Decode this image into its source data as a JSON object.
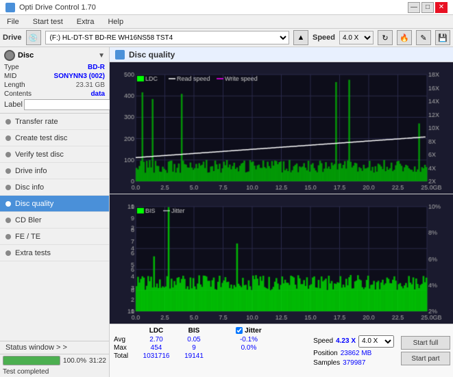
{
  "app": {
    "title": "Opti Drive Control 1.70",
    "icon": "ODC"
  },
  "title_controls": {
    "minimize": "—",
    "maximize": "□",
    "close": "✕"
  },
  "menu": {
    "items": [
      "File",
      "Start test",
      "Extra",
      "Help"
    ]
  },
  "toolbar": {
    "drive_label": "Drive",
    "drive_value": "(F:) HL-DT-ST BD-RE  WH16NS58 TST4",
    "speed_label": "Speed",
    "speed_value": "4.0 X"
  },
  "disc": {
    "header": "Disc",
    "type_label": "Type",
    "type_value": "BD-R",
    "mid_label": "MID",
    "mid_value": "SONYNN3 (002)",
    "length_label": "Length",
    "length_value": "23.31 GB",
    "contents_label": "Contents",
    "contents_value": "data",
    "label_label": "Label",
    "label_value": ""
  },
  "nav_items": [
    {
      "id": "transfer-rate",
      "label": "Transfer rate",
      "active": false
    },
    {
      "id": "create-test-disc",
      "label": "Create test disc",
      "active": false
    },
    {
      "id": "verify-test-disc",
      "label": "Verify test disc",
      "active": false
    },
    {
      "id": "drive-info",
      "label": "Drive info",
      "active": false
    },
    {
      "id": "disc-info",
      "label": "Disc info",
      "active": false
    },
    {
      "id": "disc-quality",
      "label": "Disc quality",
      "active": true
    },
    {
      "id": "cd-bler",
      "label": "CD Bler",
      "active": false
    },
    {
      "id": "fe-te",
      "label": "FE / TE",
      "active": false
    },
    {
      "id": "extra-tests",
      "label": "Extra tests",
      "active": false
    }
  ],
  "status_window_label": "Status window > >",
  "progress": {
    "percent": 100,
    "text": "100.0%",
    "time": "31:22",
    "status": "Test completed"
  },
  "disc_quality": {
    "title": "Disc quality",
    "chart1": {
      "legend": [
        "LDC",
        "Read speed",
        "Write speed"
      ],
      "y_axis_left_max": 500,
      "y_axis_right_labels": [
        "18X",
        "16X",
        "14X",
        "12X",
        "10X",
        "8X",
        "6X",
        "4X",
        "2X"
      ],
      "x_axis_label": "GB",
      "x_ticks": [
        "0.0",
        "2.5",
        "5.0",
        "7.5",
        "10.0",
        "12.5",
        "15.0",
        "17.5",
        "20.0",
        "22.5",
        "25.0"
      ]
    },
    "chart2": {
      "legend": [
        "BIS",
        "Jitter"
      ],
      "y_axis_left_max": 10,
      "y_axis_right_labels": [
        "10%",
        "8%",
        "6%",
        "4%",
        "2%"
      ],
      "x_axis_label": "GB",
      "x_ticks": [
        "0.0",
        "2.5",
        "5.0",
        "7.5",
        "10.0",
        "12.5",
        "15.0",
        "17.5",
        "20.0",
        "22.5",
        "25.0"
      ]
    }
  },
  "stats": {
    "columns": [
      "LDC",
      "BIS",
      "",
      "Jitter"
    ],
    "rows": [
      {
        "label": "Avg",
        "ldc": "2.70",
        "bis": "0.05",
        "jitter": "-0.1%"
      },
      {
        "label": "Max",
        "ldc": "454",
        "bis": "9",
        "jitter": "0.0%"
      },
      {
        "label": "Total",
        "ldc": "1031716",
        "bis": "19141",
        "jitter": ""
      }
    ],
    "jitter_label": "Jitter",
    "speed_label": "Speed",
    "speed_value": "4.23 X",
    "speed_select": "4.0 X",
    "position_label": "Position",
    "position_value": "23862 MB",
    "samples_label": "Samples",
    "samples_value": "379987",
    "btn_start_full": "Start full",
    "btn_start_part": "Start part"
  }
}
